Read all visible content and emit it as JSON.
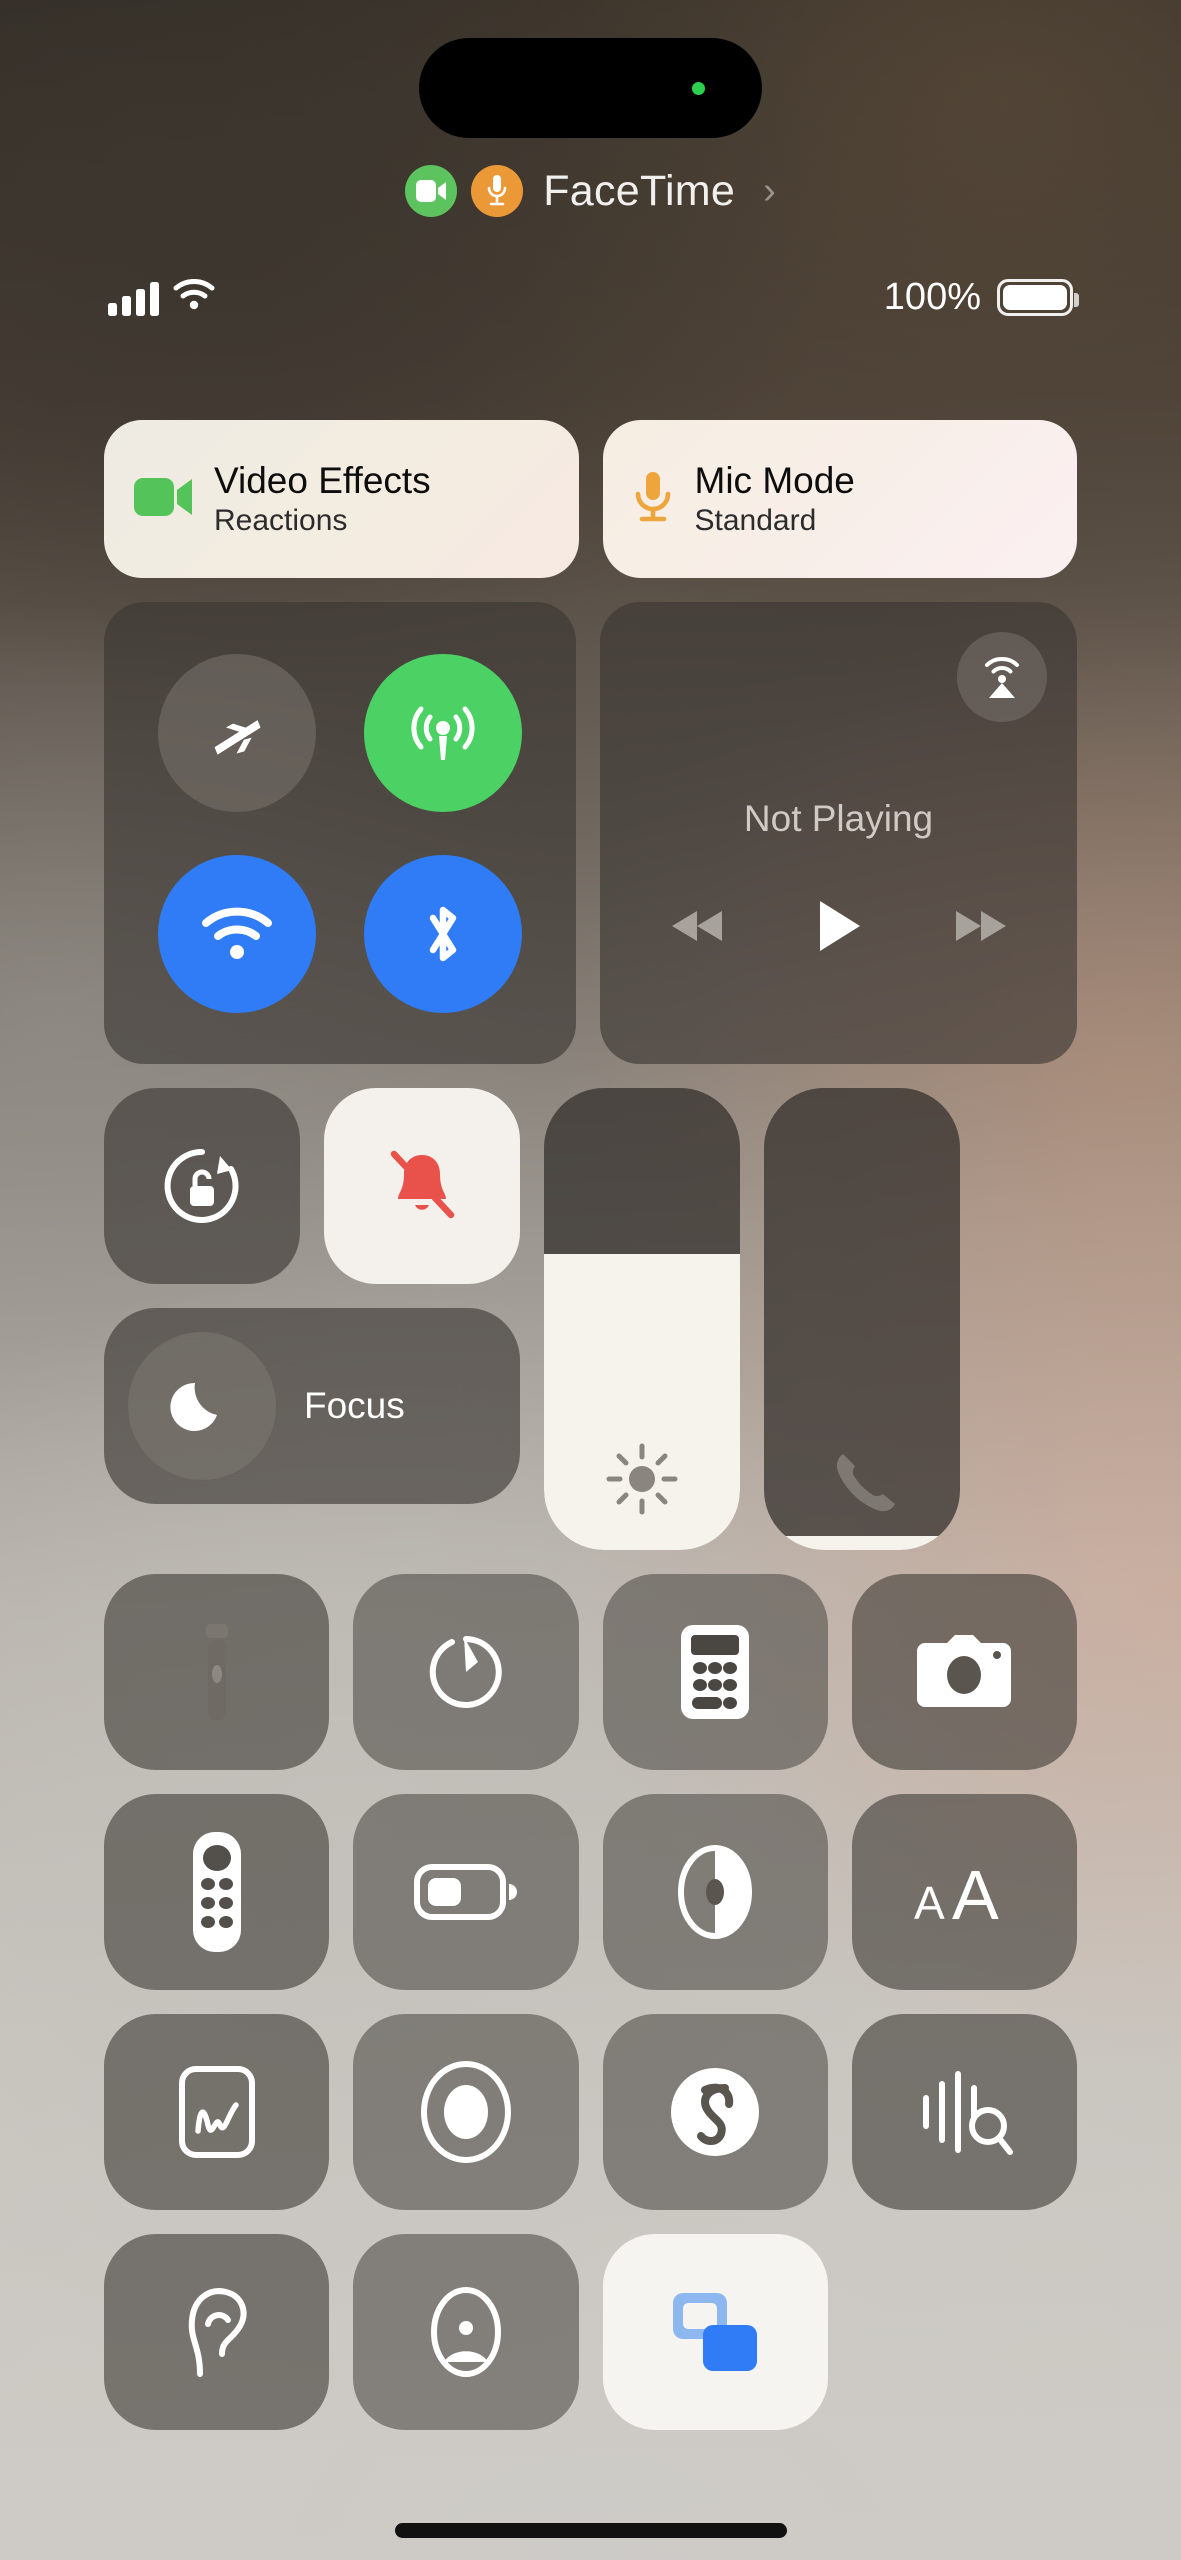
{
  "device": {
    "dynamic_island": {
      "camera_indicator_color": "#2bd14f"
    },
    "home_indicator": true
  },
  "facetime_banner": {
    "app_label": "FaceTime",
    "chevron": "›",
    "video_icon": "video-camera-icon",
    "video_icon_color": "#5cc35e",
    "mic_icon": "microphone-icon",
    "mic_icon_color": "#eb9936"
  },
  "status_bar": {
    "signal_icon": "cellular-signal-bars-icon",
    "signal_bars_filled": 4,
    "signal_bars_total": 4,
    "wifi_icon": "wifi-icon",
    "battery_percent_label": "100%",
    "battery_percent_value": 100,
    "battery_icon": "battery-full-icon"
  },
  "facetime_tiles": [
    {
      "title": "Video Effects",
      "subtitle": "Reactions",
      "icon": "video-camera-icon",
      "icon_color": "#53c35a",
      "state": "active"
    },
    {
      "title": "Mic Mode",
      "subtitle": "Standard",
      "icon": "microphone-icon",
      "icon_color": "#eda53c",
      "state": "active"
    }
  ],
  "connectivity": {
    "buttons": [
      {
        "name": "airplane-mode",
        "icon": "airplane-icon",
        "state": "off",
        "color": "#767069"
      },
      {
        "name": "cellular-data",
        "icon": "cellular-antenna-icon",
        "state": "on",
        "color": "#4cd164"
      },
      {
        "name": "wifi",
        "icon": "wifi-icon",
        "state": "on",
        "color": "#2f7cf6"
      },
      {
        "name": "bluetooth",
        "icon": "bluetooth-icon",
        "state": "on",
        "color": "#2f7cf6"
      }
    ]
  },
  "media_player": {
    "status_text": "Not Playing",
    "airplay_icon": "airplay-audio-icon",
    "rewind_icon": "rewind-icon",
    "play_icon": "play-icon",
    "forward_icon": "fast-forward-icon"
  },
  "toggles": {
    "rotation_lock": {
      "icon": "rotation-lock-icon",
      "state": "off"
    },
    "silent_mode": {
      "icon": "bell-slash-icon",
      "state": "on",
      "icon_color": "#e8524a"
    },
    "focus": {
      "label": "Focus",
      "icon": "moon-icon",
      "state": "off"
    }
  },
  "sliders": {
    "brightness": {
      "icon": "brightness-sun-icon",
      "value_percent": 64
    },
    "volume": {
      "icon": "phone-handset-icon",
      "value_percent": 3
    }
  },
  "app_grid": [
    {
      "label": "Flashlight",
      "icon": "flashlight-icon",
      "style": "dim"
    },
    {
      "label": "Timer",
      "icon": "timer-icon",
      "style": "light"
    },
    {
      "label": "Calculator",
      "icon": "calculator-icon",
      "style": "light"
    },
    {
      "label": "Camera",
      "icon": "camera-icon",
      "style": "dim"
    },
    {
      "label": "Apple TV Remote",
      "icon": "tv-remote-icon",
      "style": "dim"
    },
    {
      "label": "Low Power Mode",
      "icon": "battery-low-icon",
      "style": "light"
    },
    {
      "label": "Dark Mode",
      "icon": "dark-mode-circle-icon",
      "style": "light"
    },
    {
      "label": "Text Size",
      "icon": "text-size-icon",
      "style": "dim"
    },
    {
      "label": "Quick Note",
      "icon": "quick-note-icon",
      "style": "dim"
    },
    {
      "label": "Screen Recording",
      "icon": "screen-record-icon",
      "style": "light"
    },
    {
      "label": "Shazam",
      "icon": "shazam-icon",
      "style": "light"
    },
    {
      "label": "Sound Recognition",
      "icon": "sound-recognition-icon",
      "style": "dim"
    }
  ],
  "app_grid_partial": [
    {
      "label": "Hearing",
      "icon": "ear-icon",
      "style": "dim"
    },
    {
      "label": "Guided Access",
      "icon": "person-icon",
      "style": "light"
    },
    {
      "label": "Accessibility Shortcuts",
      "icon": "accessibility-blue-icon",
      "style": "white"
    }
  ]
}
